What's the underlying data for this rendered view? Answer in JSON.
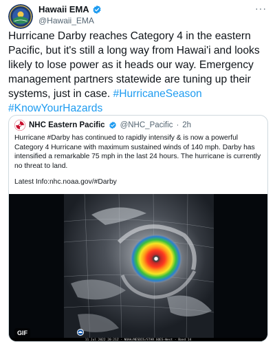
{
  "author": {
    "name": "Hawaii EMA",
    "handle": "@Hawaii_EMA",
    "verified": true,
    "avatar_icon": "hawaii-state-seal-icon"
  },
  "menu": {
    "more_label": "···"
  },
  "tweet": {
    "text": "Hurricane Darby reaches Category 4 in the eastern Pacific, but it's still a long way from Hawai'i and looks likely to lose power as it heads our way. Emergency management partners statewide are tuning up their systems, just in case.",
    "hashtags": [
      "#HurricaneSeason",
      "#KnowYourHazards"
    ]
  },
  "quoted": {
    "name": "NHC Eastern Pacific",
    "handle": "@NHC_Pacific",
    "separator": "·",
    "time": "2h",
    "verified": true,
    "avatar_icon": "nhc-logo-icon",
    "text": "Hurricane #Darby has continued to rapidly intensify & is now a powerful Category 4 Hurricane with maximum sustained winds of 140 mph. Darby has intensified a remarkable 75 mph in the last 24 hours. The hurricane is currently no threat to land.",
    "link": "Latest Info:nhc.noaa.gov/#Darby",
    "media": {
      "type": "satellite-animated-gif",
      "badge": "GIF",
      "credit": "11 Jul 2022 20:21Z - NOAA/NESDIS/STAR GOES-West - Band 14",
      "logo_icon": "noaa-logo-icon"
    }
  },
  "colors": {
    "link": "#1d9bf0",
    "verified": "#1d9bf0",
    "text_primary": "#0f1419",
    "text_secondary": "#536471",
    "border": "#cfd9de"
  }
}
